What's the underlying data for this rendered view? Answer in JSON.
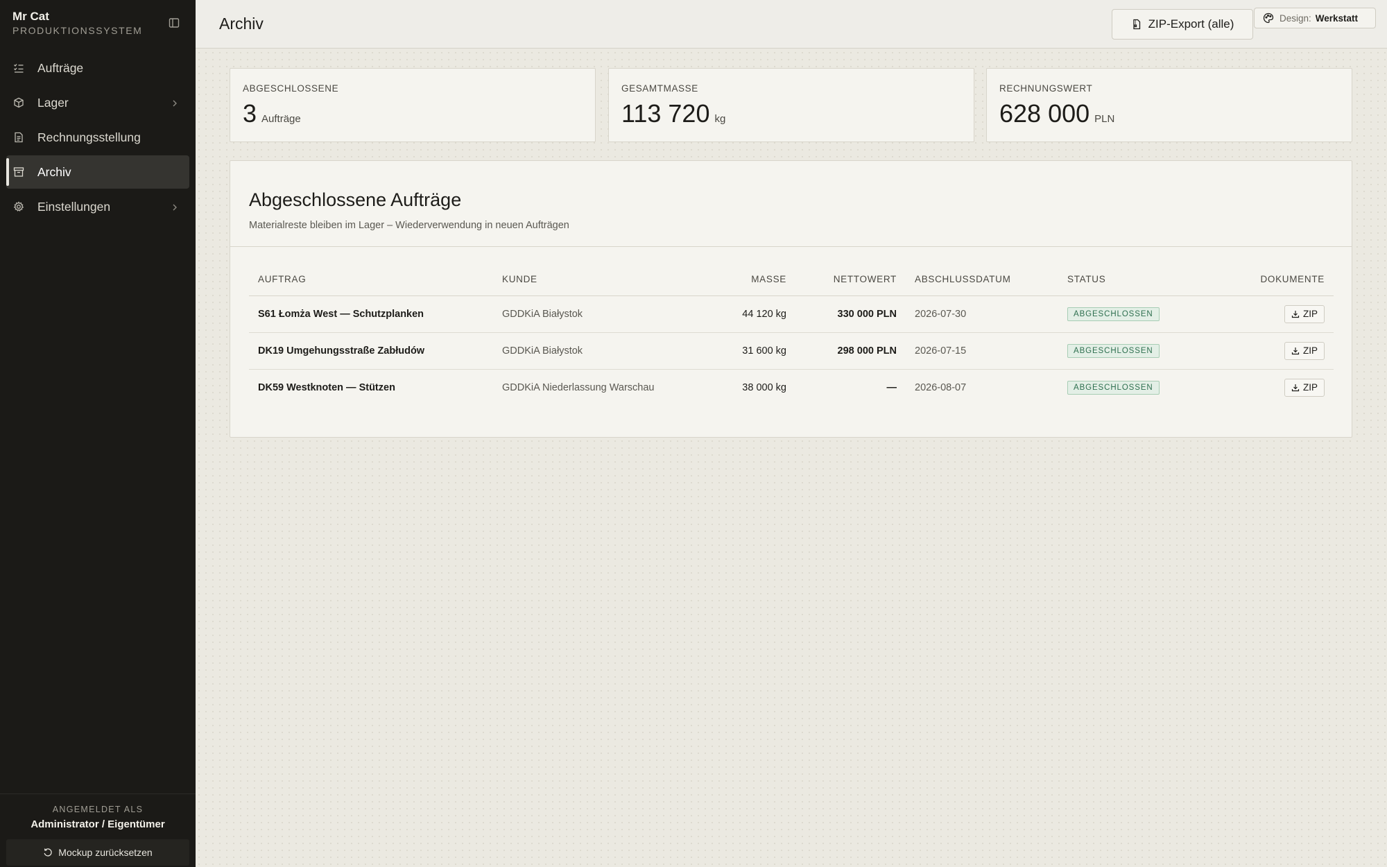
{
  "sidebar": {
    "brand_name": "Mr Cat",
    "brand_sub": "PRODUKTIONSSYSTEM",
    "items": [
      {
        "label": "Aufträge",
        "icon": "list-checks-icon"
      },
      {
        "label": "Lager",
        "icon": "box-icon"
      },
      {
        "label": "Rechnungsstellung",
        "icon": "document-icon"
      },
      {
        "label": "Archiv",
        "icon": "archive-icon"
      },
      {
        "label": "Einstellungen",
        "icon": "gear-icon"
      }
    ],
    "active": "Archiv",
    "logged_label": "ANGEMELDET ALS",
    "logged_user": "Administrator / Eigentümer",
    "reset_label": "Mockup zurücksetzen"
  },
  "header": {
    "title": "Archiv",
    "zip_all_label": "ZIP-Export (alle)",
    "design_label": "Design:",
    "design_value": "Werkstatt"
  },
  "stats": [
    {
      "label": "ABGESCHLOSSENE",
      "value": "3",
      "unit": "Aufträge"
    },
    {
      "label": "GESAMTMASSE",
      "value": "113 720",
      "unit": "kg"
    },
    {
      "label": "RECHNUNGSWERT",
      "value": "628 000",
      "unit": "PLN"
    }
  ],
  "panel": {
    "title": "Abgeschlossene Aufträge",
    "subtitle": "Materialreste bleiben im Lager – Wiederverwendung in neuen Aufträgen",
    "columns": [
      "AUFTRAG",
      "KUNDE",
      "MASSE",
      "NETTOWERT",
      "ABSCHLUSSDATUM",
      "STATUS",
      "DOKUMENTE"
    ],
    "rows": [
      {
        "order": "S61 Łomża West — Schutzplanken",
        "client": "GDDKiA Białystok",
        "mass": "44 120 kg",
        "net": "330 000 PLN",
        "date": "2026-07-30",
        "status": "ABGESCHLOSSEN",
        "doc": "ZIP"
      },
      {
        "order": "DK19 Umgehungsstraße Zabłudów",
        "client": "GDDKiA Białystok",
        "mass": "31 600 kg",
        "net": "298 000 PLN",
        "date": "2026-07-15",
        "status": "ABGESCHLOSSEN",
        "doc": "ZIP"
      },
      {
        "order": "DK59 Westknoten — Stützen",
        "client": "GDDKiA Niederlassung Warschau",
        "mass": "38 000 kg",
        "net": "—",
        "date": "2026-08-07",
        "status": "ABGESCHLOSSEN",
        "doc": "ZIP"
      }
    ]
  },
  "colors": {
    "sidebar_bg": "#1b1a17",
    "page_bg": "#ebe9e1",
    "card_bg": "#f5f4ef",
    "badge_green": "#2e6f4f"
  }
}
